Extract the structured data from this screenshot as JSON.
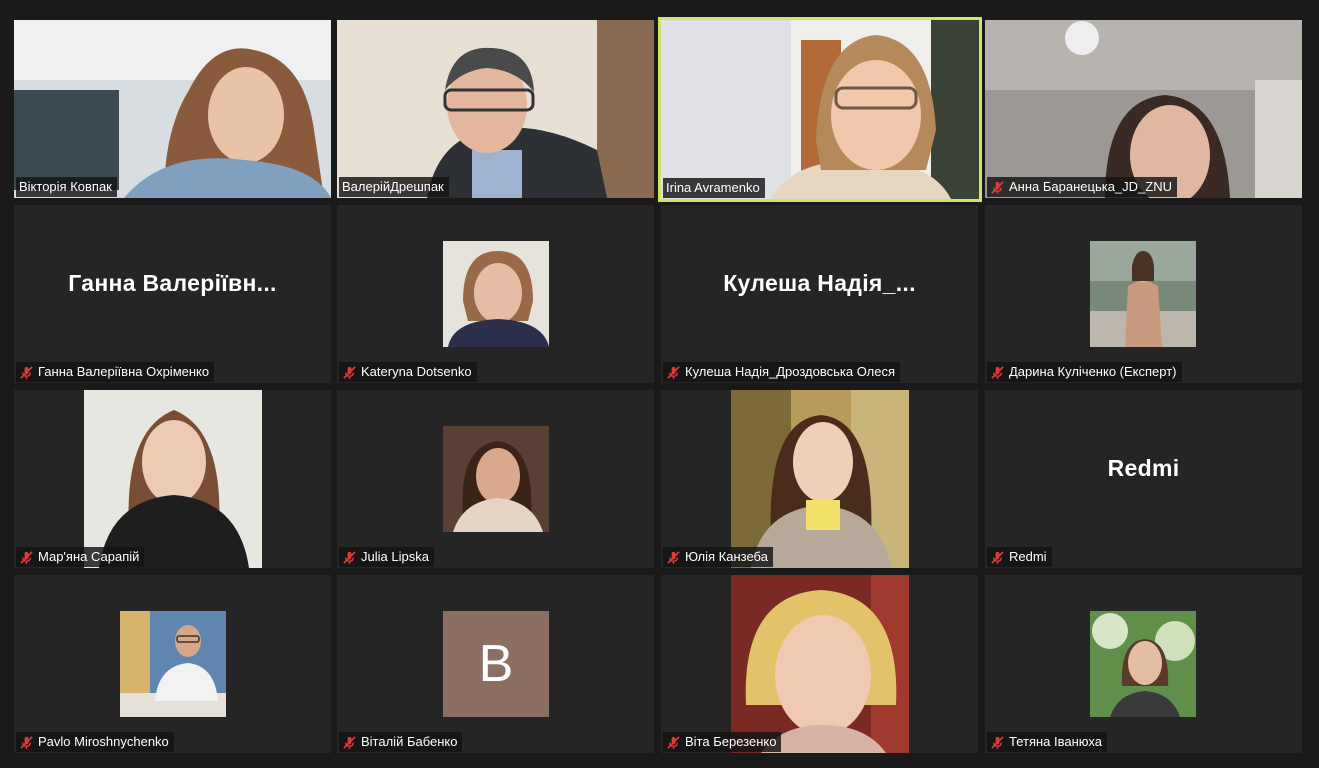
{
  "colors": {
    "background": "#1a1a1a",
    "tile": "#252525",
    "active_border": "#cfe56a",
    "mute_icon": "#e0393b",
    "avatar_bg": "#8c6f63"
  },
  "participants": [
    {
      "name": "Вікторія Ковпак",
      "muted": false,
      "active": false
    },
    {
      "name": "ВалерійДрешпак",
      "muted": false,
      "active": false
    },
    {
      "name": "Irina Avramenko",
      "muted": false,
      "active": true
    },
    {
      "name": "Анна Баранецька_JD_ZNU",
      "muted": true,
      "active": false
    },
    {
      "name": "Ганна Валеріївна Охріменко",
      "display": "Ганна  Валеріївн...",
      "muted": true
    },
    {
      "name": "Kateryna Dotsenko",
      "muted": true
    },
    {
      "name": "Кулеша Надія_Дроздовська Олеся",
      "display": "Кулеша  Надія_...",
      "muted": true
    },
    {
      "name": "Дарина Куліченко (Експерт)",
      "muted": true
    },
    {
      "name": "Мар'яна Сарапій",
      "muted": true
    },
    {
      "name": "Julia Lipska",
      "muted": true
    },
    {
      "name": "Юлія Канзеба",
      "muted": true
    },
    {
      "name": "Redmi",
      "display": "Redmi",
      "muted": true
    },
    {
      "name": "Pavlo Miroshnychenko",
      "muted": true
    },
    {
      "name": "Віталій Бабенко",
      "avatar_letter": "B",
      "muted": true
    },
    {
      "name": "Віта Березенко",
      "muted": true
    },
    {
      "name": "Тетяна  Іванюха",
      "muted": true
    }
  ]
}
